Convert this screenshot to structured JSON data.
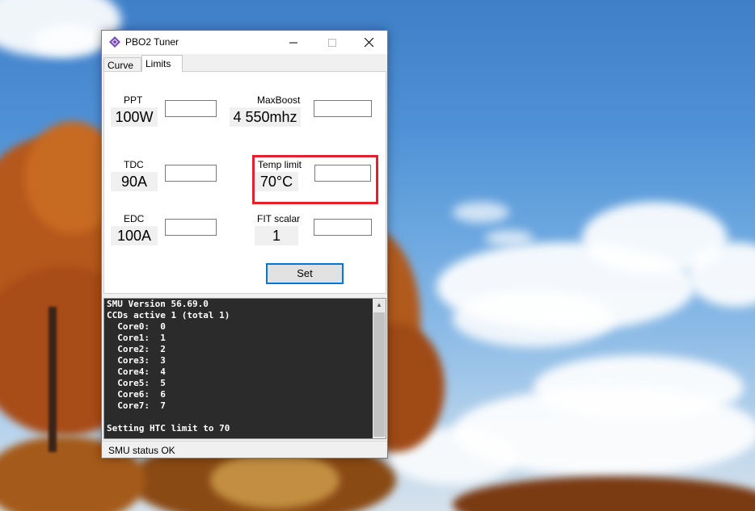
{
  "window": {
    "title": "PBO2 Tuner",
    "icon": "diamond-app-icon"
  },
  "tabs": [
    {
      "label": "Curve",
      "selected": false
    },
    {
      "label": "Limits",
      "selected": true
    }
  ],
  "limits": {
    "ppt": {
      "label": "PPT",
      "value": "100W",
      "input": ""
    },
    "tdc": {
      "label": "TDC",
      "value": "90A",
      "input": ""
    },
    "edc": {
      "label": "EDC",
      "value": "100A",
      "input": ""
    },
    "maxboost": {
      "label": "MaxBoost",
      "value": "4 550mhz",
      "input": ""
    },
    "temp": {
      "label": "Temp limit",
      "value": "70°C",
      "input": ""
    },
    "fit": {
      "label": "FIT scalar",
      "value": "1",
      "input": ""
    }
  },
  "set_button": {
    "label": "Set"
  },
  "console": {
    "lines": [
      "SMU Version 56.69.0",
      "CCDs active 1 (total 1)",
      "  Core0:  0",
      "  Core1:  1",
      "  Core2:  2",
      "  Core3:  3",
      "  Core4:  4",
      "  Core5:  5",
      "  Core6:  6",
      "  Core7:  7",
      "",
      "Setting HTC limit to 70"
    ]
  },
  "status": {
    "text": "SMU status OK"
  },
  "colors": {
    "highlight": "#e3202b",
    "button_border": "#0078d7",
    "console_bg": "#2b2b2b"
  }
}
